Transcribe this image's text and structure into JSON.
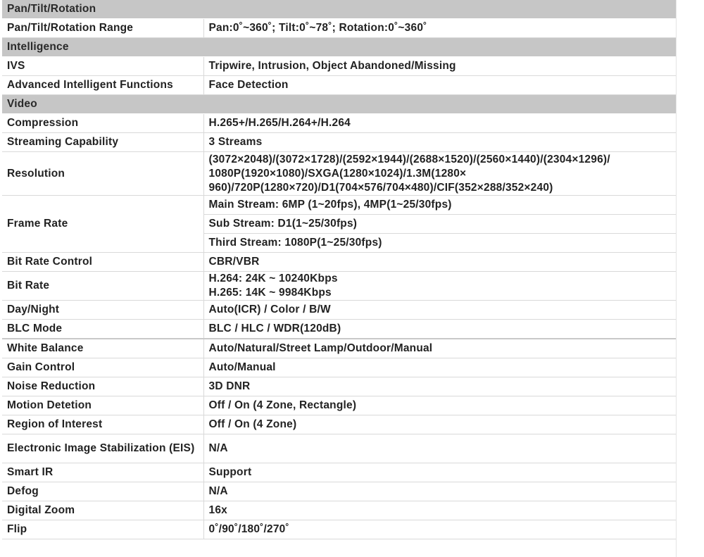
{
  "table": {
    "sections": [
      {
        "title": "Pan/Tilt/Rotation",
        "rows": [
          {
            "label": "Pan/Tilt/Rotation Range",
            "values": [
              "Pan:0˚~360˚; Tilt:0˚~78˚; Rotation:0˚~360˚"
            ]
          }
        ]
      },
      {
        "title": "Intelligence",
        "rows": [
          {
            "label": "IVS",
            "values": [
              "Tripwire, Intrusion, Object Abandoned/Missing"
            ]
          },
          {
            "label": "Advanced Intelligent Functions",
            "values": [
              "Face Detection"
            ]
          }
        ]
      },
      {
        "title": "Video",
        "rows": [
          {
            "label": "Compression",
            "values": [
              "H.265+/H.265/H.264+/H.264"
            ]
          },
          {
            "label": "Streaming Capability",
            "values": [
              "3 Streams"
            ]
          },
          {
            "label": "Resolution",
            "values": [
              "(3072×2048)/(3072×1728)/(2592×1944)/(2688×1520)/(2560×1440)/(2304×1296)/",
              "1080P(1920×1080)/SXGA(1280×1024)/1.3M(1280×",
              "960)/720P(1280×720)/D1(704×576/704×480)/CIF(352×288/352×240)"
            ]
          },
          {
            "label": "Frame Rate",
            "sub_values": [
              "Main Stream: 6MP (1~20fps), 4MP(1~25/30fps)",
              "Sub Stream: D1(1~25/30fps)",
              "Third Stream: 1080P(1~25/30fps)"
            ]
          },
          {
            "label": "Bit Rate Control",
            "values": [
              "CBR/VBR"
            ]
          },
          {
            "label": "Bit Rate",
            "values": [
              "H.264: 24K ~ 10240Kbps",
              "H.265: 14K ~ 9984Kbps"
            ]
          },
          {
            "label": "Day/Night",
            "values": [
              "Auto(ICR) / Color / B/W"
            ]
          },
          {
            "label": "BLC Mode",
            "values": [
              "BLC / HLC / WDR(120dB)"
            ]
          },
          {
            "label": "White Balance",
            "values": [
              "Auto/Natural/Street Lamp/Outdoor/Manual"
            ],
            "thick_top": true
          },
          {
            "label": "Gain Control",
            "values": [
              "Auto/Manual"
            ]
          },
          {
            "label": "Noise Reduction",
            "values": [
              "3D DNR"
            ]
          },
          {
            "label": "Motion Detetion",
            "values": [
              "Off / On (4 Zone, Rectangle)"
            ]
          },
          {
            "label": "Region of Interest",
            "values": [
              "Off / On (4 Zone)"
            ]
          },
          {
            "label": "Electronic Image Stabilization (EIS)",
            "values": [
              "N/A"
            ],
            "label_lines": 2
          },
          {
            "label": "Smart IR",
            "values": [
              "Support"
            ]
          },
          {
            "label": "Defog",
            "values": [
              "N/A"
            ]
          },
          {
            "label": "Digital Zoom",
            "values": [
              "16x"
            ]
          },
          {
            "label": "Flip",
            "values": [
              "0˚/90˚/180˚/270˚"
            ]
          }
        ]
      }
    ]
  }
}
